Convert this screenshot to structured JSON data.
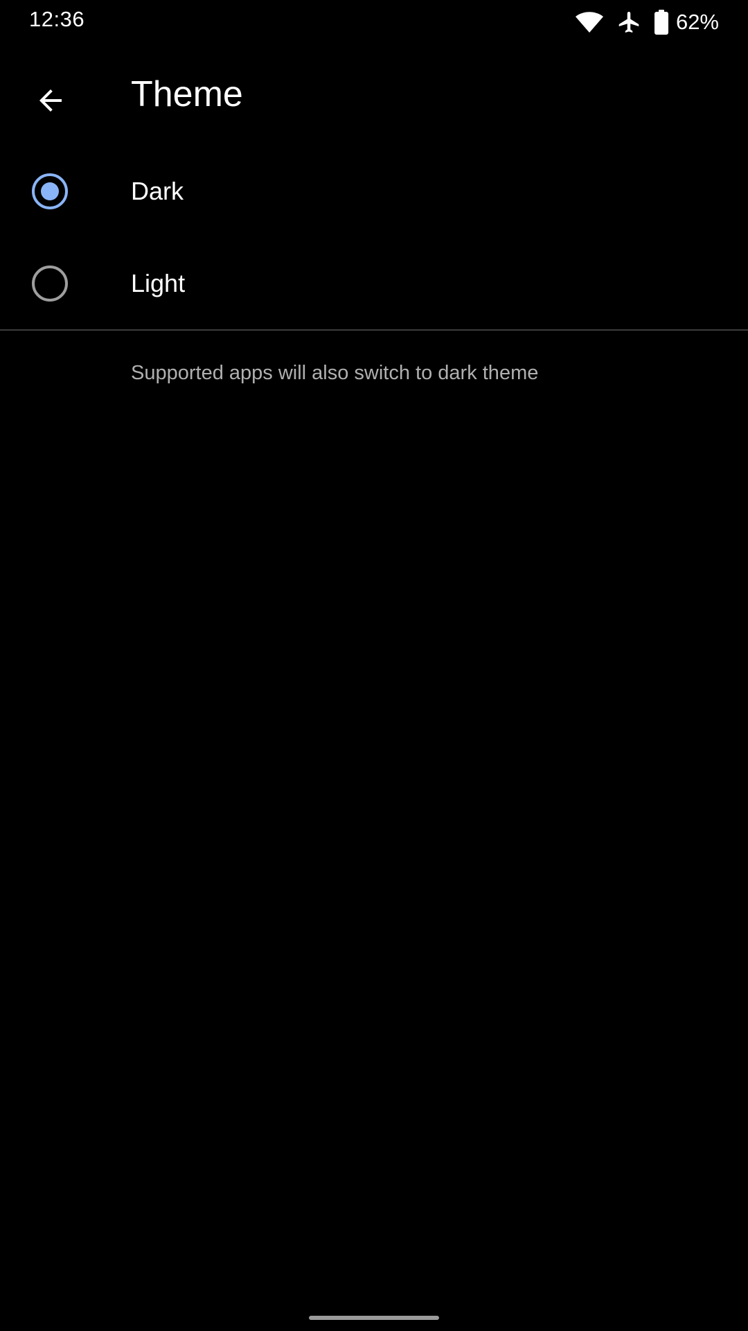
{
  "status_bar": {
    "time": "12:36",
    "battery": "62%",
    "icons": [
      "wifi-icon",
      "airplane-icon",
      "battery-icon"
    ]
  },
  "header": {
    "title": "Theme",
    "back_icon": "arrow-back-icon"
  },
  "options": [
    {
      "label": "Dark",
      "selected": true
    },
    {
      "label": "Light",
      "selected": false
    }
  ],
  "footer_note": "Supported apps will also switch to dark theme",
  "colors": {
    "background": "#000000",
    "accent": "#8ab4f8",
    "radio_unchecked": "#9e9e9e",
    "secondary_text": "#b0b0b0"
  }
}
